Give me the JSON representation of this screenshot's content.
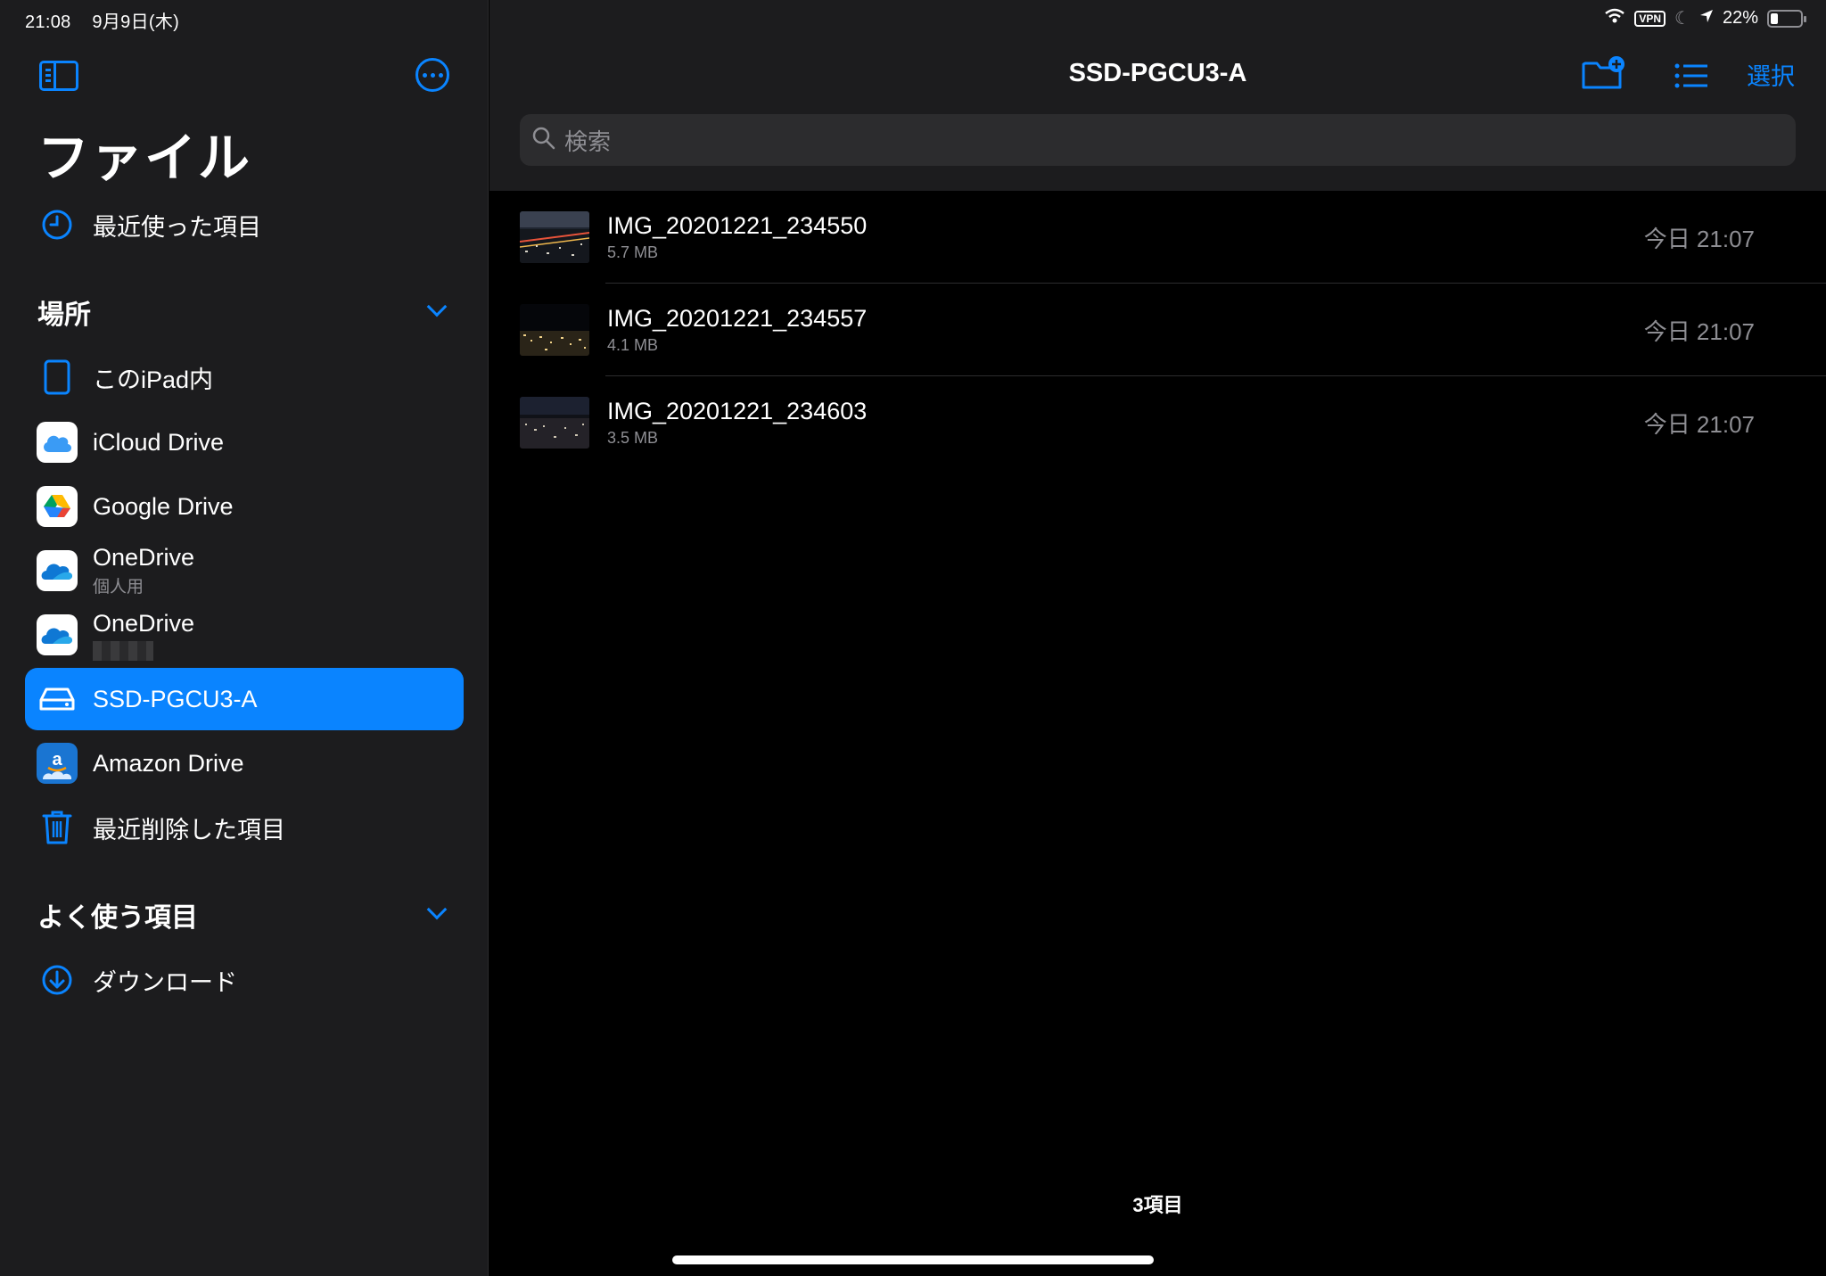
{
  "status_bar": {
    "time": "21:08",
    "date": "9月9日(木)",
    "vpn": "VPN",
    "battery": "22%"
  },
  "sidebar": {
    "title": "ファイル",
    "recents": "最近使った項目",
    "locations_header": "場所",
    "locations": [
      {
        "label": "このiPad内",
        "icon": "ipad-icon"
      },
      {
        "label": "iCloud Drive",
        "icon": "icloud-icon"
      },
      {
        "label": "Google Drive",
        "icon": "google-drive-icon"
      },
      {
        "label": "OneDrive",
        "sub": "個人用",
        "icon": "onedrive-icon"
      },
      {
        "label": "OneDrive",
        "icon": "onedrive-icon"
      },
      {
        "label": "SSD-PGCU3-A",
        "icon": "drive-icon",
        "selected": true
      },
      {
        "label": "Amazon Drive",
        "icon": "amazon-drive-icon"
      },
      {
        "label": "最近削除した項目",
        "icon": "trash-icon"
      }
    ],
    "favorites_header": "よく使う項目",
    "favorites": [
      {
        "label": "ダウンロード",
        "icon": "download-icon"
      }
    ]
  },
  "main": {
    "title": "SSD-PGCU3-A",
    "select_label": "選択",
    "search_placeholder": "検索",
    "files": [
      {
        "name": "IMG_20201221_234550",
        "size": "5.7 MB",
        "date": "今日 21:07"
      },
      {
        "name": "IMG_20201221_234557",
        "size": "4.1 MB",
        "date": "今日 21:07"
      },
      {
        "name": "IMG_20201221_234603",
        "size": "3.5 MB",
        "date": "今日 21:07"
      }
    ],
    "item_count": "3項目"
  },
  "colors": {
    "accent": "#0a84ff",
    "sidebar_bg": "#1c1c1e",
    "main_bg": "#000000",
    "secondary_text": "#8e8e93"
  }
}
